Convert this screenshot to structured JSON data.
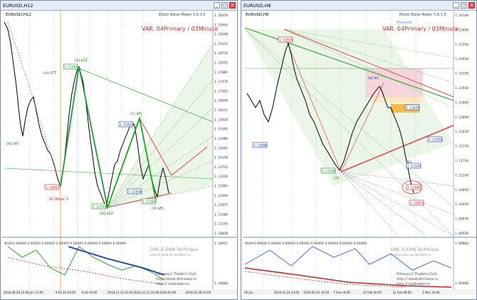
{
  "left": {
    "title": "EURUSD,H12",
    "indicator": "Elliott Wave Maker 5.6.1.5",
    "scenario": "VAR. 04Primary / 03Minute",
    "sub_label": "WLM 0.00000 0.00000 0.00000 0.00000 0.00000 0.00000 0.00000 0.00000",
    "watermark_1": "DML & EWA Technique",
    "watermark_2": "potnik-post @ rambler.ru",
    "watermark_3": "Fibonacci Traders Club",
    "watermark_4": "http://www.dml-ewa.ru",
    "watermark_5": "http:// redtrader.ru",
    "prices": [
      "1.20370",
      "1.19956",
      "1.19540",
      "1.19125",
      "1.18710",
      "1.18295",
      "1.17885",
      "1.17470",
      "1.17055",
      "1.16640",
      "1.16225",
      "1.15810",
      "1.15395",
      "1.14980",
      "1.14565",
      "1.14150",
      "1.13735",
      "1.13320",
      "1.12905",
      "1.12490",
      "1.12075",
      "1.11660",
      "1.11245",
      "1.10830"
    ],
    "sub_prices": [
      "1.10915",
      "1.10660"
    ],
    "dates": [
      "2018.08.28 12:00",
      "Jun 12:00",
      "9.03.16 16:00",
      "9.24 16:00",
      "2018.11.12 23:54",
      "2018.12.13 16:00",
      "2019.01.08",
      "2019.01.28 23:00"
    ],
    "wave_labels": [
      "(iv) iCT",
      "[a] a22",
      "[b] a22",
      "(c) aFL",
      "(d) aFL",
      "A1 Minor 3",
      "[w] (iii)"
    ],
    "price_boxes": [
      "1.12364",
      "1.10802",
      "1.12145",
      "1.15928",
      "1.12930",
      "1.12360"
    ]
  },
  "right": {
    "title": "EURUSD,H8",
    "indicator": "Elliott Wave Maker 5.6.1.5",
    "scenario": "VAR. 04Primary / 03Minute",
    "minuete": "Minuette",
    "sub_label": "WLM 0.00000 0.00000 0.00000 0.00000 0.00000 0.00000 0.00000 0.00000",
    "watermark_1": "DML & EWA Technique",
    "watermark_2": "potnik-post @ rambler.ru",
    "watermark_3": "Fibonacci Traders Club",
    "watermark_4": "http:// www.dml-ewa.ru",
    "watermark_5": "http:// redtrader.ru",
    "prices": [
      "1.16140",
      "1.15690",
      "1.15250",
      "1.14810",
      "1.14370",
      "1.13930",
      "1.13490",
      "1.13050",
      "1.12610",
      "1.12170",
      "1.11730",
      "1.11290",
      "1.10850",
      "1.10410",
      "1.09970",
      "1.09530"
    ],
    "sub_prices": [
      "1.09666",
      "1.09400"
    ],
    "dates": [
      "16 Jan",
      "2019.01.24 23:00",
      "2019.02.01 16:00",
      "7 Feb 16:00",
      "15 Feb 00:00",
      "22 Feb 08:00",
      "1 Mar 16:00"
    ],
    "price_boxes": [
      "1.14458",
      "1.13638",
      "1.12928",
      "1.11800",
      "1.11450",
      "1.13145",
      "1.12888",
      "1.10853"
    ],
    "wave_labels": [
      "(a) b2",
      "(b)",
      "(c)",
      "[a]",
      "b2 AFL",
      "[c]"
    ]
  }
}
